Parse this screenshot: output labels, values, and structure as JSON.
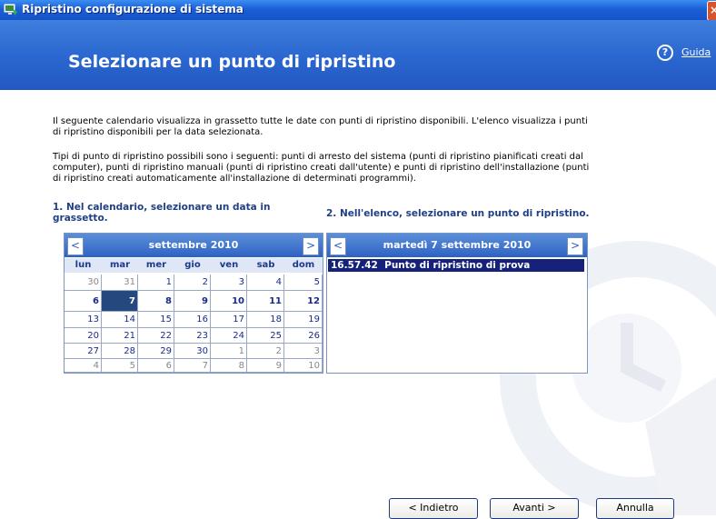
{
  "window": {
    "title": "Ripristino configurazione di sistema",
    "close_label": "×"
  },
  "header": {
    "title": "Selezionare un punto di ripristino",
    "help_label": "Guida",
    "help_icon": "?"
  },
  "intro": {
    "p1_line1": "Il seguente calendario visualizza in grassetto tutte le date con punti di ripristino disponibili. L'elenco visualizza i punti",
    "p1_line2": "di ripristino disponibili per la data selezionata.",
    "p2_line1": "Tipi di punto di ripristino possibili sono i seguenti: punti di arresto del sistema (punti di ripristino pianificati creati dal",
    "p2_line2": "computer), punti di ripristino manuali (punti di ripristino creati dall'utente) e punti di ripristino dell'installazione (punti",
    "p2_line3": "di ripristino creati automaticamente all'installazione di determinati programmi)."
  },
  "steps": {
    "step1_line1": "1. Nel calendario, selezionare un data in",
    "step1_line2": "grassetto.",
    "step2": "2. Nell'elenco, selezionare un punto di ripristino."
  },
  "calendar": {
    "prev": "<",
    "next": ">",
    "month": "settembre 2010",
    "weekdays": [
      "lun",
      "mar",
      "mer",
      "gio",
      "ven",
      "sab",
      "dom"
    ],
    "weeks": [
      [
        "30",
        "31",
        "1",
        "2",
        "3",
        "4",
        "5"
      ],
      [
        "6",
        "7",
        "8",
        "9",
        "10",
        "11",
        "12"
      ],
      [
        "13",
        "14",
        "15",
        "16",
        "17",
        "18",
        "19"
      ],
      [
        "20",
        "21",
        "22",
        "23",
        "24",
        "25",
        "26"
      ],
      [
        "27",
        "28",
        "29",
        "30",
        "1",
        "2",
        "3"
      ],
      [
        "4",
        "5",
        "6",
        "7",
        "8",
        "9",
        "10"
      ]
    ],
    "selected_day": "7"
  },
  "list": {
    "prev": "<",
    "next": ">",
    "date": "martedì 7 settembre 2010",
    "items": [
      {
        "time": "16.57.42",
        "description": "Punto di ripristino di prova"
      }
    ]
  },
  "buttons": {
    "back": "< Indietro",
    "next": "Avanti >",
    "cancel": "Annulla"
  },
  "colors": {
    "title_bar": "#1c5fd6",
    "header": "#2a66cf",
    "selection": "#16227a"
  }
}
